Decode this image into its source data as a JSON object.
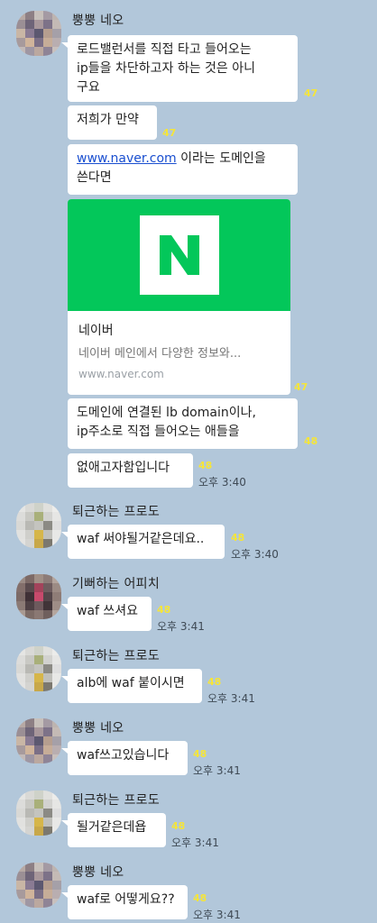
{
  "senders": {
    "s1": "뿡뿡 네오",
    "s2": "퇴근하는 프로도",
    "s3": "기뻐하는 어피치"
  },
  "messages": {
    "m1": "로드밸런서를 직접 타고 들어오는\nip들을 차단하고자 하는 것은 아니\n구요",
    "m2": "저희가 만약",
    "m3_link": "www.naver.com",
    "m3_rest": " 이라는 도메인을\n쓴다면",
    "m5": "도메인에 연결된 lb domain이나,\nip주소로 직접 들어오는 애들을",
    "m6": "없애고자함입니다",
    "m7": "waf 써야될거같은데요..",
    "m8": "waf 쓰셔요",
    "m9": "alb에 waf 붙이시면",
    "m10": "waf쓰고있습니다",
    "m11": "될거같은데욥",
    "m12": "waf로 어떻게요??"
  },
  "link_card": {
    "logo_letter": "N",
    "title": "네이버",
    "description": "네이버 메인에서 다양한 정보와...",
    "url": "www.naver.com",
    "brand_color": "#03c75a"
  },
  "meta": {
    "unread_47": "47",
    "unread_48": "48",
    "time_340": "오후 3:40",
    "time_341": "오후 3:41"
  },
  "colors": {
    "background": "#b2c7da",
    "bubble": "#ffffff",
    "unread": "#f5e53a"
  }
}
